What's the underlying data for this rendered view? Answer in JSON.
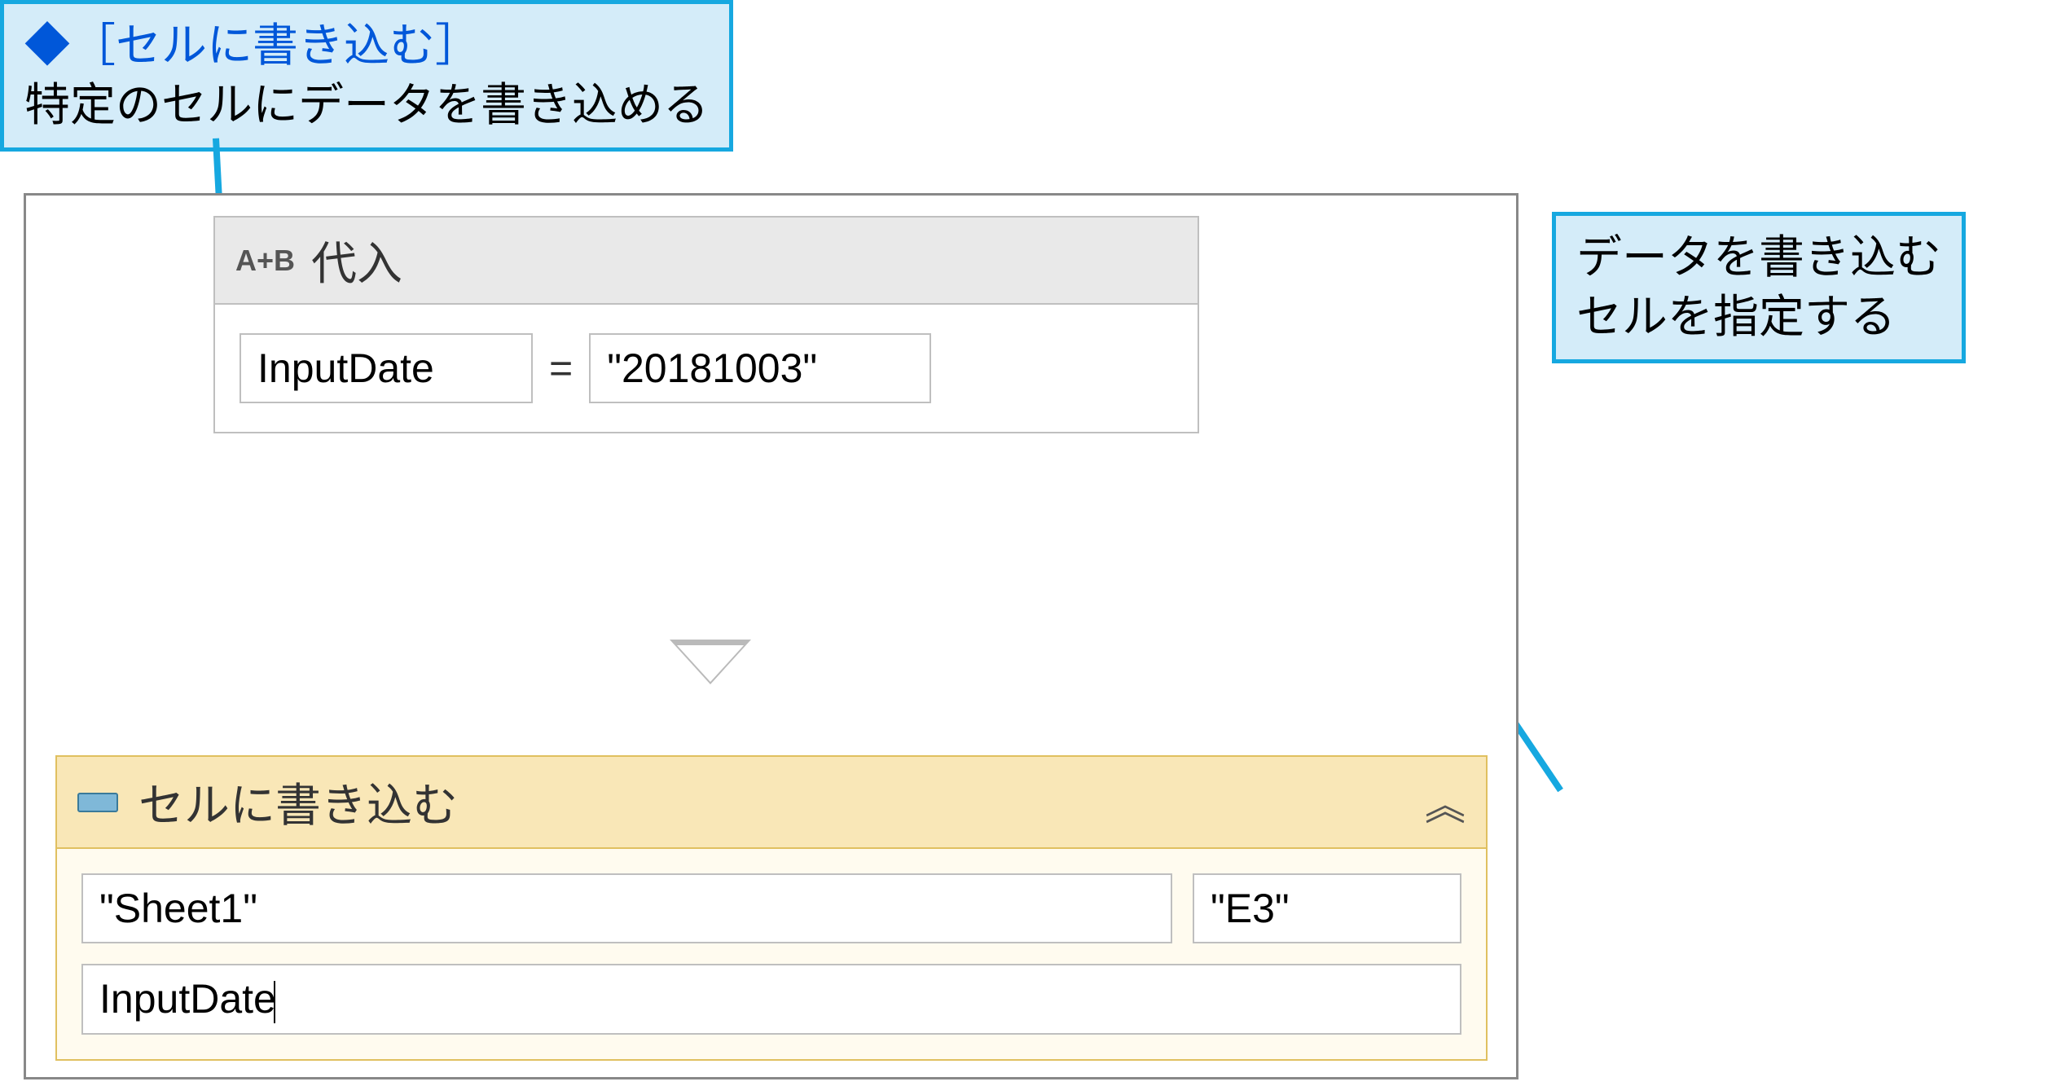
{
  "callouts": {
    "top": {
      "bracket_text": "［セルに書き込む］",
      "desc": "特定のセルにデータを書き込める"
    },
    "right": {
      "line1": "データを書き込む",
      "line2": "セルを指定する"
    }
  },
  "assign": {
    "icon": "A+B",
    "title": "代入",
    "left_value": "InputDate",
    "eq": "=",
    "right_value": "\"20181003\""
  },
  "write_cell": {
    "title": "セルに書き込む",
    "sheet_value": "\"Sheet1\"",
    "cell_value": "\"E3\"",
    "input_value": "InputDate"
  }
}
